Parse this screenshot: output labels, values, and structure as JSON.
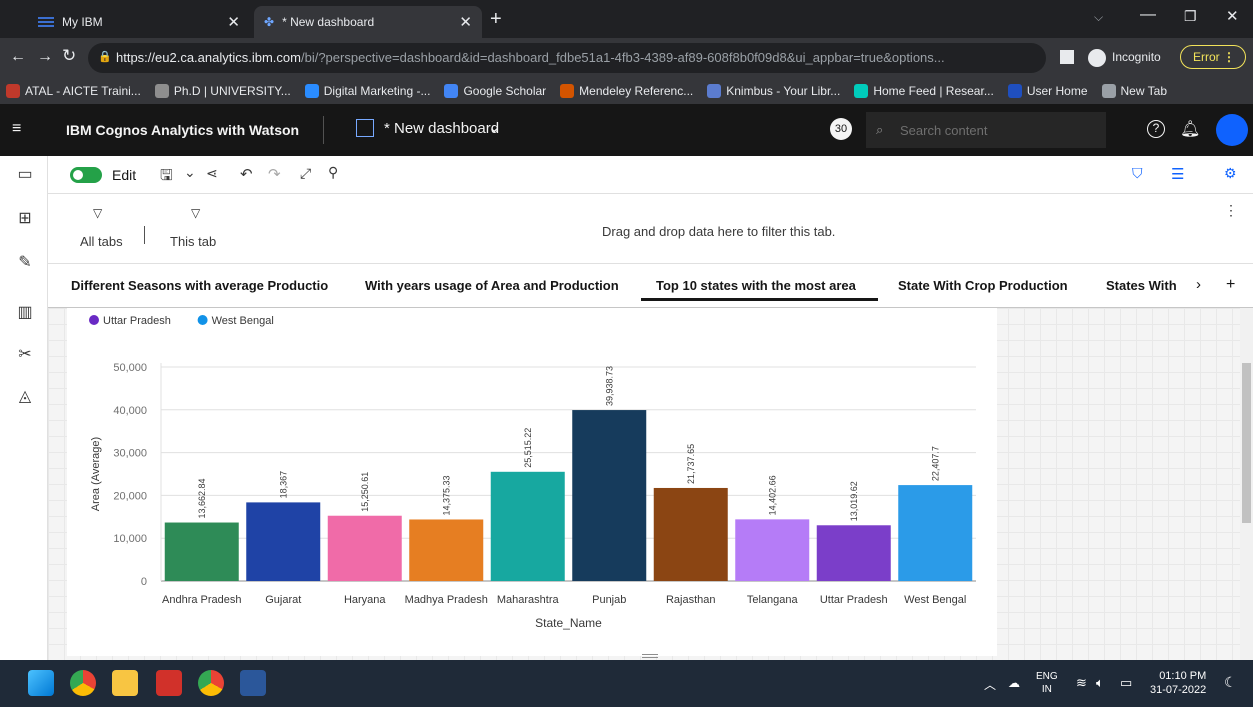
{
  "browser": {
    "tabs": [
      {
        "title": "My IBM"
      },
      {
        "title": "* New dashboard"
      }
    ],
    "url_host": "https://eu2.ca.analytics.ibm.com",
    "url_path": "/bi/?perspective=dashboard&id=dashboard_fdbe51a1-4fb3-4389-af89-608f8b0f09d8&ui_appbar=true&options...",
    "profile_label": "Incognito",
    "error_label": "Error",
    "bookmarks": [
      {
        "label": "ATAL - AICTE Traini...",
        "color": "#c0392b"
      },
      {
        "label": "Ph.D | UNIVERSITY...",
        "color": "#8e8e8e"
      },
      {
        "label": "Digital Marketing -...",
        "color": "#2a8cff"
      },
      {
        "label": "Google Scholar",
        "color": "#4285f4"
      },
      {
        "label": "Mendeley Referenc...",
        "color": "#d35400"
      },
      {
        "label": "Knimbus - Your Libr...",
        "color": "#5b7ccf"
      },
      {
        "label": "Home Feed | Resear...",
        "color": "#00ccbb"
      },
      {
        "label": "User Home",
        "color": "#1f4fbf"
      },
      {
        "label": "New Tab",
        "color": "#9aa0a6"
      }
    ]
  },
  "app": {
    "product": "IBM Cognos Analytics with Watson",
    "dashboard_title": "* New dashboard",
    "notification_count": "30",
    "search_placeholder": "Search content"
  },
  "toolbar": {
    "edit_label": "Edit"
  },
  "filters": {
    "all_tabs": "All tabs",
    "this_tab": "This tab",
    "drop_hint": "Drag and drop data here to filter this tab."
  },
  "dashboard_tabs": [
    {
      "label": "Different Seasons with average Productio"
    },
    {
      "label": "With years usage of Area and Production"
    },
    {
      "label": "Top 10 states with the most area"
    },
    {
      "label": "State With Crop Production"
    },
    {
      "label": "States With"
    }
  ],
  "chart_data": {
    "type": "bar",
    "legend": [
      {
        "name": "Uttar Pradesh",
        "color": "#6929c4"
      },
      {
        "name": "West Bengal",
        "color": "#1192e8"
      }
    ],
    "categories": [
      "Andhra Pradesh",
      "Gujarat",
      "Haryana",
      "Madhya Pradesh",
      "Maharashtra",
      "Punjab",
      "Rajasthan",
      "Telangana",
      "Uttar Pradesh",
      "West Bengal"
    ],
    "values": [
      13662.84,
      18367,
      15250.61,
      14375.33,
      25515.22,
      39938.73,
      21737.65,
      14402.66,
      13019.62,
      22407.7
    ],
    "value_labels": [
      "13,662.84",
      "18,367",
      "15,250.61",
      "14,375.33",
      "25,515.22",
      "39,938.73",
      "21,737.65",
      "14,402.66",
      "13,019.62",
      "22,407.7"
    ],
    "colors": [
      "#2e8b57",
      "#1f43a6",
      "#f06ba8",
      "#e67e22",
      "#17a8a0",
      "#163b5c",
      "#8b4513",
      "#b57cf7",
      "#7b3ec9",
      "#2b9be8"
    ],
    "xlabel": "State_Name",
    "ylabel": "Area (Average)",
    "ylim": [
      0,
      50000
    ],
    "yticks": [
      0,
      10000,
      20000,
      30000,
      40000,
      50000
    ],
    "ytick_labels": [
      "0",
      "10,000",
      "20,000",
      "30,000",
      "40,000",
      "50,000"
    ],
    "grid": true
  },
  "taskbar": {
    "language": "ENG",
    "region": "IN",
    "time": "01:10 PM",
    "date": "31-07-2022"
  }
}
